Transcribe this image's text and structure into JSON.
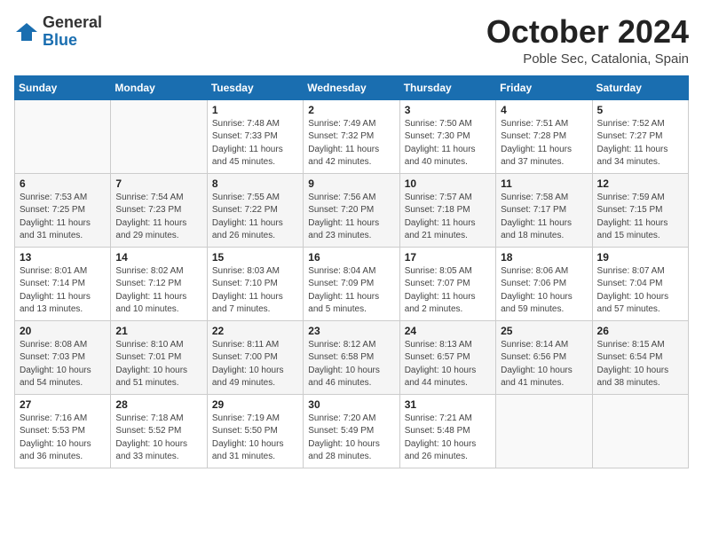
{
  "logo": {
    "general": "General",
    "blue": "Blue"
  },
  "header": {
    "month": "October 2024",
    "location": "Poble Sec, Catalonia, Spain"
  },
  "weekdays": [
    "Sunday",
    "Monday",
    "Tuesday",
    "Wednesday",
    "Thursday",
    "Friday",
    "Saturday"
  ],
  "weeks": [
    [
      {
        "day": "",
        "sunrise": "",
        "sunset": "",
        "daylight": ""
      },
      {
        "day": "",
        "sunrise": "",
        "sunset": "",
        "daylight": ""
      },
      {
        "day": "1",
        "sunrise": "Sunrise: 7:48 AM",
        "sunset": "Sunset: 7:33 PM",
        "daylight": "Daylight: 11 hours and 45 minutes."
      },
      {
        "day": "2",
        "sunrise": "Sunrise: 7:49 AM",
        "sunset": "Sunset: 7:32 PM",
        "daylight": "Daylight: 11 hours and 42 minutes."
      },
      {
        "day": "3",
        "sunrise": "Sunrise: 7:50 AM",
        "sunset": "Sunset: 7:30 PM",
        "daylight": "Daylight: 11 hours and 40 minutes."
      },
      {
        "day": "4",
        "sunrise": "Sunrise: 7:51 AM",
        "sunset": "Sunset: 7:28 PM",
        "daylight": "Daylight: 11 hours and 37 minutes."
      },
      {
        "day": "5",
        "sunrise": "Sunrise: 7:52 AM",
        "sunset": "Sunset: 7:27 PM",
        "daylight": "Daylight: 11 hours and 34 minutes."
      }
    ],
    [
      {
        "day": "6",
        "sunrise": "Sunrise: 7:53 AM",
        "sunset": "Sunset: 7:25 PM",
        "daylight": "Daylight: 11 hours and 31 minutes."
      },
      {
        "day": "7",
        "sunrise": "Sunrise: 7:54 AM",
        "sunset": "Sunset: 7:23 PM",
        "daylight": "Daylight: 11 hours and 29 minutes."
      },
      {
        "day": "8",
        "sunrise": "Sunrise: 7:55 AM",
        "sunset": "Sunset: 7:22 PM",
        "daylight": "Daylight: 11 hours and 26 minutes."
      },
      {
        "day": "9",
        "sunrise": "Sunrise: 7:56 AM",
        "sunset": "Sunset: 7:20 PM",
        "daylight": "Daylight: 11 hours and 23 minutes."
      },
      {
        "day": "10",
        "sunrise": "Sunrise: 7:57 AM",
        "sunset": "Sunset: 7:18 PM",
        "daylight": "Daylight: 11 hours and 21 minutes."
      },
      {
        "day": "11",
        "sunrise": "Sunrise: 7:58 AM",
        "sunset": "Sunset: 7:17 PM",
        "daylight": "Daylight: 11 hours and 18 minutes."
      },
      {
        "day": "12",
        "sunrise": "Sunrise: 7:59 AM",
        "sunset": "Sunset: 7:15 PM",
        "daylight": "Daylight: 11 hours and 15 minutes."
      }
    ],
    [
      {
        "day": "13",
        "sunrise": "Sunrise: 8:01 AM",
        "sunset": "Sunset: 7:14 PM",
        "daylight": "Daylight: 11 hours and 13 minutes."
      },
      {
        "day": "14",
        "sunrise": "Sunrise: 8:02 AM",
        "sunset": "Sunset: 7:12 PM",
        "daylight": "Daylight: 11 hours and 10 minutes."
      },
      {
        "day": "15",
        "sunrise": "Sunrise: 8:03 AM",
        "sunset": "Sunset: 7:10 PM",
        "daylight": "Daylight: 11 hours and 7 minutes."
      },
      {
        "day": "16",
        "sunrise": "Sunrise: 8:04 AM",
        "sunset": "Sunset: 7:09 PM",
        "daylight": "Daylight: 11 hours and 5 minutes."
      },
      {
        "day": "17",
        "sunrise": "Sunrise: 8:05 AM",
        "sunset": "Sunset: 7:07 PM",
        "daylight": "Daylight: 11 hours and 2 minutes."
      },
      {
        "day": "18",
        "sunrise": "Sunrise: 8:06 AM",
        "sunset": "Sunset: 7:06 PM",
        "daylight": "Daylight: 10 hours and 59 minutes."
      },
      {
        "day": "19",
        "sunrise": "Sunrise: 8:07 AM",
        "sunset": "Sunset: 7:04 PM",
        "daylight": "Daylight: 10 hours and 57 minutes."
      }
    ],
    [
      {
        "day": "20",
        "sunrise": "Sunrise: 8:08 AM",
        "sunset": "Sunset: 7:03 PM",
        "daylight": "Daylight: 10 hours and 54 minutes."
      },
      {
        "day": "21",
        "sunrise": "Sunrise: 8:10 AM",
        "sunset": "Sunset: 7:01 PM",
        "daylight": "Daylight: 10 hours and 51 minutes."
      },
      {
        "day": "22",
        "sunrise": "Sunrise: 8:11 AM",
        "sunset": "Sunset: 7:00 PM",
        "daylight": "Daylight: 10 hours and 49 minutes."
      },
      {
        "day": "23",
        "sunrise": "Sunrise: 8:12 AM",
        "sunset": "Sunset: 6:58 PM",
        "daylight": "Daylight: 10 hours and 46 minutes."
      },
      {
        "day": "24",
        "sunrise": "Sunrise: 8:13 AM",
        "sunset": "Sunset: 6:57 PM",
        "daylight": "Daylight: 10 hours and 44 minutes."
      },
      {
        "day": "25",
        "sunrise": "Sunrise: 8:14 AM",
        "sunset": "Sunset: 6:56 PM",
        "daylight": "Daylight: 10 hours and 41 minutes."
      },
      {
        "day": "26",
        "sunrise": "Sunrise: 8:15 AM",
        "sunset": "Sunset: 6:54 PM",
        "daylight": "Daylight: 10 hours and 38 minutes."
      }
    ],
    [
      {
        "day": "27",
        "sunrise": "Sunrise: 7:16 AM",
        "sunset": "Sunset: 5:53 PM",
        "daylight": "Daylight: 10 hours and 36 minutes."
      },
      {
        "day": "28",
        "sunrise": "Sunrise: 7:18 AM",
        "sunset": "Sunset: 5:52 PM",
        "daylight": "Daylight: 10 hours and 33 minutes."
      },
      {
        "day": "29",
        "sunrise": "Sunrise: 7:19 AM",
        "sunset": "Sunset: 5:50 PM",
        "daylight": "Daylight: 10 hours and 31 minutes."
      },
      {
        "day": "30",
        "sunrise": "Sunrise: 7:20 AM",
        "sunset": "Sunset: 5:49 PM",
        "daylight": "Daylight: 10 hours and 28 minutes."
      },
      {
        "day": "31",
        "sunrise": "Sunrise: 7:21 AM",
        "sunset": "Sunset: 5:48 PM",
        "daylight": "Daylight: 10 hours and 26 minutes."
      },
      {
        "day": "",
        "sunrise": "",
        "sunset": "",
        "daylight": ""
      },
      {
        "day": "",
        "sunrise": "",
        "sunset": "",
        "daylight": ""
      }
    ]
  ]
}
